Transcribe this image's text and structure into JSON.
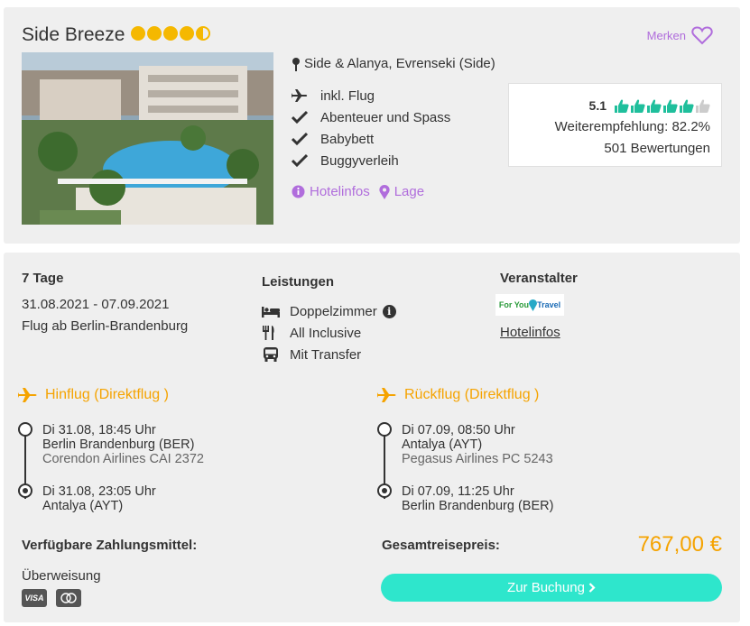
{
  "hotel": {
    "name": "Side Breeze",
    "stars": 4.5,
    "location": "Side & Alanya, Evrenseki (Side)",
    "merken_label": "Merken",
    "features": [
      {
        "icon": "plane-icon",
        "label": "inkl. Flug"
      },
      {
        "icon": "check-icon",
        "label": "Abenteuer und Spass"
      },
      {
        "icon": "check-icon",
        "label": "Babybett"
      },
      {
        "icon": "check-icon",
        "label": "Buggyverleih"
      }
    ],
    "links": {
      "hotelinfos": "Hotelinfos",
      "lage": "Lage"
    },
    "rating": {
      "score": "5.1",
      "thumbs_filled": 5,
      "thumbs_total": 6,
      "recommendation": "Weiterempfehlung: 82.2%",
      "reviews": "501 Bewertungen"
    }
  },
  "trip": {
    "duration": "7 Tage",
    "dates": "31.08.2021 - 07.09.2021",
    "departure": "Flug ab Berlin-Brandenburg"
  },
  "services": {
    "heading": "Leistungen",
    "items": [
      {
        "icon": "bed-icon",
        "label": "Doppelzimmer"
      },
      {
        "icon": "cutlery-icon",
        "label": "All Inclusive"
      },
      {
        "icon": "bus-icon",
        "label": "Mit Transfer"
      }
    ]
  },
  "operator": {
    "heading": "Veranstalter",
    "logo_text_a": "For You",
    "logo_text_b": "Travel",
    "link": "Hotelinfos"
  },
  "outbound": {
    "title": "Hinflug (Direktflug )",
    "dep_time": "Di 31.08, 18:45 Uhr",
    "dep_airport": "Berlin Brandenburg (BER)",
    "airline": "Corendon Airlines CAI 2372",
    "arr_time": "Di 31.08, 23:05 Uhr",
    "arr_airport": "Antalya (AYT)"
  },
  "inbound": {
    "title": "Rückflug (Direktflug )",
    "dep_time": "Di 07.09, 08:50 Uhr",
    "dep_airport": "Antalya (AYT)",
    "airline": "Pegasus Airlines PC 5243",
    "arr_time": "Di 07.09, 11:25 Uhr",
    "arr_airport": "Berlin Brandenburg (BER)"
  },
  "payment": {
    "heading": "Verfügbare Zahlungsmittel:",
    "method": "Überweisung",
    "cards": [
      "VISA",
      "MC"
    ]
  },
  "price": {
    "label": "Gesamtreisepreis:",
    "value": "767,00 €"
  },
  "booking": {
    "button_label": "Zur Buchung"
  },
  "colors": {
    "accent_purple": "#b06ddc",
    "accent_orange": "#f5a300",
    "star_gold": "#f5b800",
    "button_teal": "#2ee6cc",
    "thumb_green": "#1fbf9c"
  }
}
